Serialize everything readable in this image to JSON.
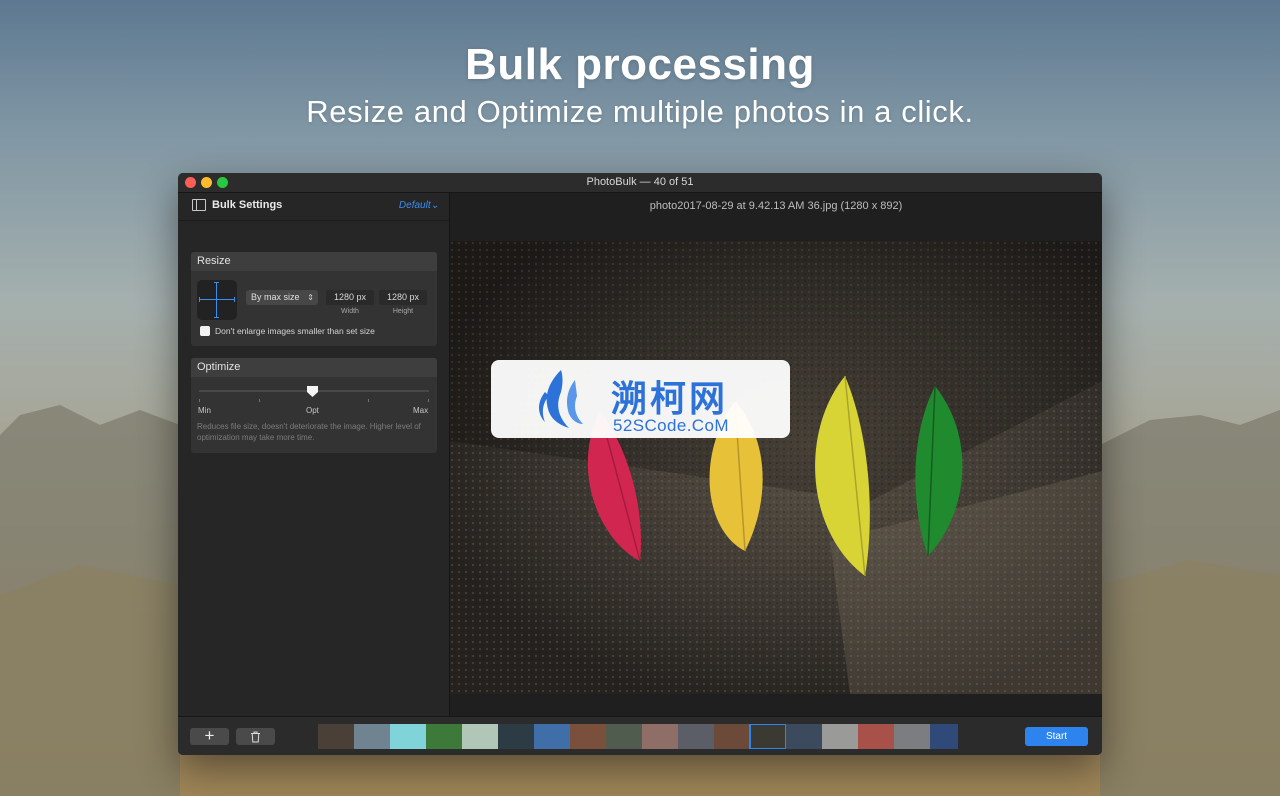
{
  "hero": {
    "title": "Bulk processing",
    "subtitle": "Resize and Optimize multiple photos in a click."
  },
  "window": {
    "title": "PhotoBulk — 40 of 51"
  },
  "sidebar": {
    "title": "Bulk Settings",
    "preset": "Default",
    "preset_chevron": "⌄",
    "resize": {
      "heading": "Resize",
      "mode": "By max size",
      "width_value": "1280 px",
      "width_label": "Width",
      "height_value": "1280 px",
      "height_label": "Height",
      "dont_enlarge_label": "Don't enlarge images smaller than set size",
      "dont_enlarge_checked": false
    },
    "optimize": {
      "heading": "Optimize",
      "slider_min_label": "Min",
      "slider_mid_label": "Opt",
      "slider_max_label": "Max",
      "slider_level": 0.5,
      "description": "Reduces file size, doesn't deteriorate the image. Higher level of optimization may take more time."
    }
  },
  "preview": {
    "file_name": "photo2017-08-29 at 9.42.13 AM 36.jpg (1280 x 892)"
  },
  "bottombar": {
    "add_label": "+",
    "delete_icon": "trash-icon",
    "start_label": "Start",
    "selected_thumbnail": 14
  },
  "watermark": {
    "chinese": "溯柯网",
    "english": "52SCode.CoM"
  },
  "colors": {
    "accent": "#2e84ee",
    "window_bg": "#1e1e1e",
    "panel_bg": "#333333"
  }
}
